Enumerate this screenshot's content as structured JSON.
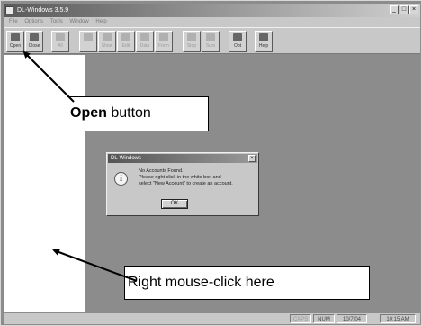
{
  "window": {
    "title": "DL-Windows 3.5.9",
    "controls": [
      "_",
      "□",
      "×"
    ]
  },
  "menu": {
    "items": [
      "File",
      "Options",
      "Tools",
      "Window",
      "Help"
    ]
  },
  "toolbar": {
    "buttons": [
      {
        "label": "Open",
        "icon": "open-folder-icon",
        "enabled": true
      },
      {
        "label": "Close",
        "icon": "close-folder-icon",
        "enabled": true
      },
      {
        "label": "All",
        "icon": "all-icon",
        "enabled": false
      },
      {
        "label": "",
        "icon": "record-icon",
        "enabled": false
      },
      {
        "label": "Show",
        "icon": "show-icon",
        "enabled": false
      },
      {
        "label": "Edit",
        "icon": "edit-icon",
        "enabled": false
      },
      {
        "label": "Data",
        "icon": "data-icon",
        "enabled": false
      },
      {
        "label": "Form",
        "icon": "form-icon",
        "enabled": false
      },
      {
        "label": "Stop",
        "icon": "stop-icon",
        "enabled": false
      },
      {
        "label": "Sum",
        "icon": "sum-icon",
        "enabled": false
      },
      {
        "label": "Opt",
        "icon": "options-icon",
        "enabled": true
      },
      {
        "label": "Help",
        "icon": "help-icon",
        "enabled": true
      }
    ]
  },
  "dialog": {
    "title": "DL-Windows",
    "icon": "info-icon",
    "message_lines": [
      "No Accounts Found.",
      "Please right click in the white box and",
      "select \"New Account\" to create an account."
    ],
    "ok_label": "OK",
    "close_label": "×"
  },
  "statusbar": {
    "caps": "CAPS",
    "num": "NUM",
    "date": "10/7/04",
    "time": "10:15 AM"
  },
  "annotations": {
    "open_bold": "Open",
    "open_rest": " button",
    "right_click": "Right mouse-click here"
  }
}
